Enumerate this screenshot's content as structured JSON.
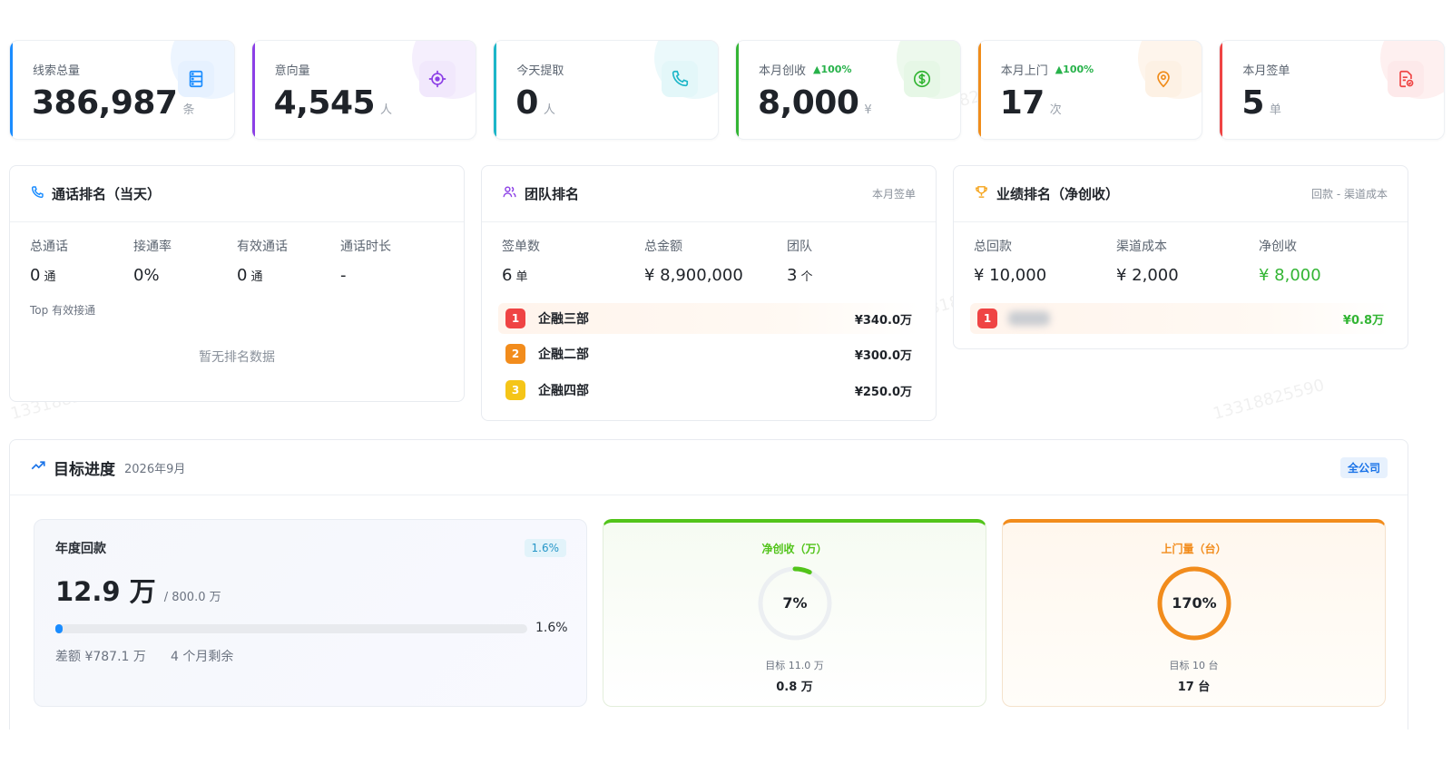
{
  "watermark": "13318825590",
  "stats": [
    {
      "label": "线索总量",
      "value": "386,987",
      "unit": "条",
      "trend": "",
      "color": "#1a8cff",
      "bg": "#e6f1ff",
      "icon": "server-icon"
    },
    {
      "label": "意向量",
      "value": "4,545",
      "unit": "人",
      "trend": "",
      "color": "#8c3fe6",
      "bg": "#f1e8fc",
      "icon": "target-icon"
    },
    {
      "label": "今天提取",
      "value": "0",
      "unit": "人",
      "trend": "",
      "color": "#1cb6c8",
      "bg": "#e3f7f9",
      "icon": "phone-icon"
    },
    {
      "label": "本月创收",
      "value": "8,000",
      "unit": "¥",
      "trend": "▲100%",
      "color": "#33b534",
      "bg": "#e6f7e6",
      "icon": "dollar-icon"
    },
    {
      "label": "本月上门",
      "value": "17",
      "unit": "次",
      "trend": "▲100%",
      "color": "#f08c1a",
      "bg": "#fdf1e4",
      "icon": "location-pin-icon"
    },
    {
      "label": "本月签单",
      "value": "5",
      "unit": "单",
      "trend": "",
      "color": "#ef4444",
      "bg": "#fde9ea",
      "icon": "document-check-icon"
    }
  ],
  "calls": {
    "title": "通话排名（当天）",
    "metrics": [
      {
        "label": "总通话",
        "value": "0",
        "unit": "通"
      },
      {
        "label": "接通率",
        "value": "0%",
        "unit": ""
      },
      {
        "label": "有效通话",
        "value": "0",
        "unit": "通"
      },
      {
        "label": "通话时长",
        "value": "-",
        "unit": ""
      }
    ],
    "top_label": "Top 有效接通",
    "empty": "暂无排名数据"
  },
  "team": {
    "title": "团队排名",
    "right": "本月签单",
    "metrics": [
      {
        "label": "签单数",
        "value": "6",
        "unit": "单"
      },
      {
        "label": "总金额",
        "value": "¥ 8,900,000",
        "unit": ""
      },
      {
        "label": "团队",
        "value": "3",
        "unit": "个"
      }
    ],
    "ranks": [
      {
        "n": "1",
        "name": "企融三部",
        "value": "¥340.0万",
        "color": "#ef4444"
      },
      {
        "n": "2",
        "name": "企融二部",
        "value": "¥300.0万",
        "color": "#f28c1c"
      },
      {
        "n": "3",
        "name": "企融四部",
        "value": "¥250.0万",
        "color": "#f5c518"
      }
    ]
  },
  "perf": {
    "title": "业绩排名（净创收）",
    "right": "回款 - 渠道成本",
    "metrics": [
      {
        "label": "总回款",
        "value": "¥ 10,000",
        "unit": ""
      },
      {
        "label": "渠道成本",
        "value": "¥ 2,000",
        "unit": ""
      },
      {
        "label": "净创收",
        "value": "¥ 8,000",
        "unit": ""
      }
    ],
    "rank": {
      "n": "1",
      "value": "¥0.8万"
    }
  },
  "goal": {
    "title": "目标进度",
    "period": "2026年9月",
    "scope": "全公司",
    "annual": {
      "label": "年度回款",
      "pct_badge": "1.6%",
      "value": "12.9 万",
      "total": "/ 800.0 万",
      "progress": 1.6,
      "pct_text": "1.6%",
      "gap": "差额 ¥787.1 万",
      "remaining": "4 个月剩余"
    },
    "net": {
      "label": "净创收（万）",
      "pct": 7,
      "pct_text": "7%",
      "target": "目标 11.0 万",
      "actual": "0.8 万",
      "color": "#52c41a"
    },
    "visit": {
      "label": "上门量（台）",
      "pct": 170,
      "pct_text": "170%",
      "target": "目标 10 台",
      "actual": "17 台",
      "color": "#f28c1c"
    }
  }
}
